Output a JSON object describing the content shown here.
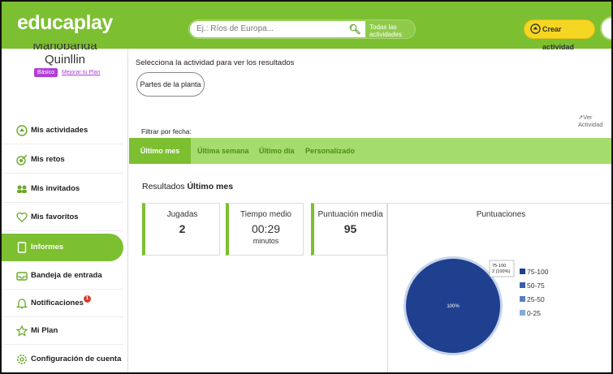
{
  "header": {
    "logo": "educaplay",
    "search_placeholder": "Ej.: Ríos de Europa...",
    "search_all": "Todas las actividades",
    "create_label": "Crear actividad"
  },
  "user": {
    "name_line1": "Manobanda",
    "name_line2": "Quinllin",
    "plan_badge": "Básico",
    "upgrade_link": "Mejorar tu Plan"
  },
  "sidebar": {
    "items": [
      {
        "label": "Mis actividades",
        "icon": "activities-icon"
      },
      {
        "label": "Mis retos",
        "icon": "challenge-icon"
      },
      {
        "label": "Mis invitados",
        "icon": "guests-icon"
      },
      {
        "label": "Mis favoritos",
        "icon": "heart-icon"
      },
      {
        "label": "Informes",
        "icon": "report-icon",
        "active": true
      },
      {
        "label": "Bandeja de entrada",
        "icon": "inbox-icon"
      },
      {
        "label": "Notificaciones",
        "icon": "bell-icon",
        "badge": "1"
      },
      {
        "label": "Mi Plan",
        "icon": "star-icon"
      },
      {
        "label": "Configuración de cuenta",
        "icon": "gear-icon"
      }
    ]
  },
  "main": {
    "select_label": "Selecciona la actividad para ver los resultados",
    "activity_pill": "Partes de la planta",
    "ver_actividad": "Ver Actividad",
    "filter_label": "Filtrar por fecha:",
    "filters": [
      "Último mes",
      "Última semana",
      "Último día",
      "Personalizado"
    ],
    "active_filter": "Último mes",
    "results_label": "Resultados",
    "results_period": "Último mes"
  },
  "stats": {
    "jugadas_label": "Jugadas",
    "jugadas_value": "2",
    "tiempo_label": "Tiempo medio",
    "tiempo_value": "00:29",
    "tiempo_unit": "minutos",
    "puntuacion_label": "Puntuación media",
    "puntuacion_value": "95"
  },
  "chart_data": {
    "type": "pie",
    "title": "Puntuaciones",
    "categories": [
      "75-100",
      "50-75",
      "25-50",
      "0-25"
    ],
    "values": [
      2,
      0,
      0,
      0
    ],
    "colors": [
      "#1f3f8f",
      "#3a5fa8",
      "#5b7fc0",
      "#86a9d6"
    ],
    "slice_label": "100%",
    "tooltip_line1": "75-100",
    "tooltip_line2": "2 (100%)",
    "legend_position": "right"
  },
  "colors": {
    "brand_green": "#7cbf31",
    "filter_bar": "#a6dc6e",
    "create_yellow": "#f5d623",
    "plan_purple": "#b03ed6"
  }
}
